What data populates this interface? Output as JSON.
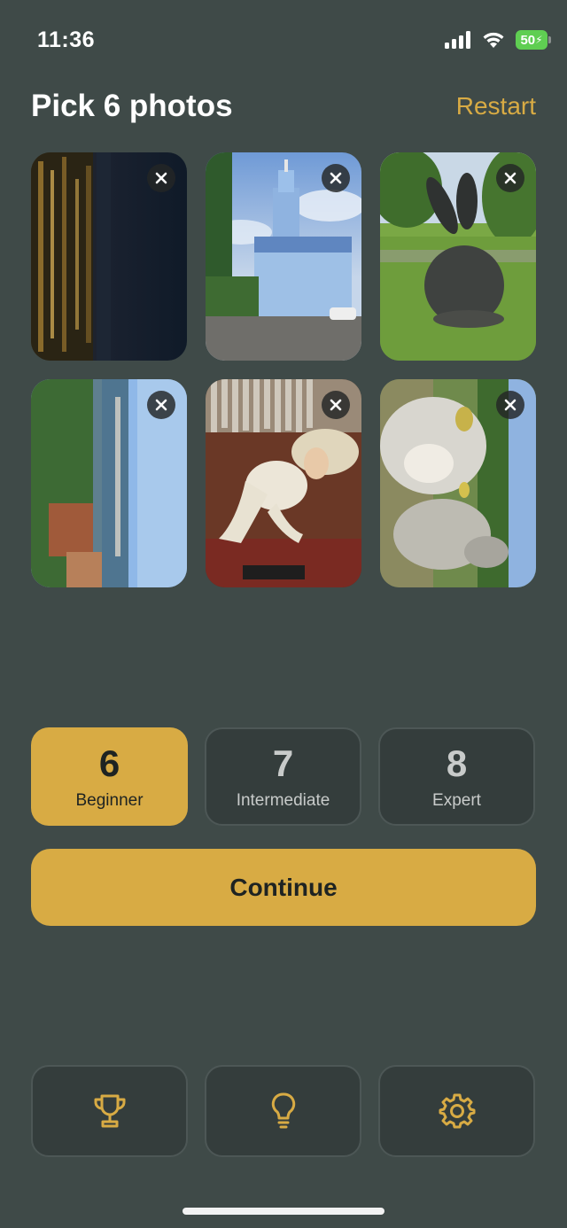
{
  "status_bar": {
    "time": "11:36",
    "battery": "50"
  },
  "header": {
    "title": "Pick 6 photos",
    "restart_label": "Restart"
  },
  "photos": [
    {
      "subject": "city skyline at night reflected in river"
    },
    {
      "subject": "blue church with bell tower"
    },
    {
      "subject": "dark rabbit sculpture on lawn"
    },
    {
      "subject": "aerial view of river and city"
    },
    {
      "subject": "statue with wide hat in front of organ pipes"
    },
    {
      "subject": "two sheep in a field"
    }
  ],
  "difficulty": {
    "levels": [
      {
        "number": "6",
        "name": "Beginner",
        "selected": true
      },
      {
        "number": "7",
        "name": "Intermediate",
        "selected": false
      },
      {
        "number": "8",
        "name": "Expert",
        "selected": false
      }
    ]
  },
  "continue_label": "Continue",
  "bottom_nav": [
    {
      "icon": "trophy-icon"
    },
    {
      "icon": "lightbulb-icon"
    },
    {
      "icon": "gear-icon"
    }
  ],
  "colors": {
    "background": "#3f4a48",
    "accent": "#d8ab44",
    "card": "#343d3c"
  }
}
